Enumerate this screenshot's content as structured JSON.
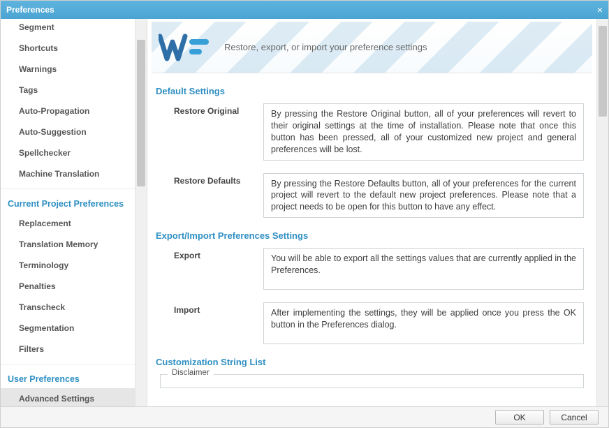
{
  "window": {
    "title": "Preferences"
  },
  "sidebar": {
    "top_items": [
      "Segment",
      "Shortcuts",
      "Warnings",
      "Tags",
      "Auto-Propagation",
      "Auto-Suggestion",
      "Spellchecker",
      "Machine Translation"
    ],
    "sections": [
      {
        "title": "Current Project Preferences",
        "items": [
          "Replacement",
          "Translation Memory",
          "Terminology",
          "Penalties",
          "Transcheck",
          "Segmentation",
          "Filters"
        ]
      },
      {
        "title": "User Preferences",
        "items": [
          "Advanced Settings"
        ]
      }
    ],
    "selected": "Advanced Settings"
  },
  "banner": {
    "text": "Restore, export, or import your preference settings"
  },
  "sections": {
    "default": {
      "title": "Default Settings",
      "restore_original": {
        "label": "Restore Original",
        "desc": "By pressing the Restore Original button, all of your preferences will revert to their original settings at the time of installation. Please note that once this button has been pressed, all of your customized new project and general preferences will be lost."
      },
      "restore_defaults": {
        "label": "Restore Defaults",
        "desc": "By pressing the Restore Defaults button, all of your preferences for the current project will revert to the default new project preferences. Please note that a project needs to be open for this button to have any effect."
      }
    },
    "exportimport": {
      "title": "Export/Import Preferences Settings",
      "export": {
        "label": "Export",
        "desc": "You will be able to export all the settings values that are currently applied in the Preferences."
      },
      "import": {
        "label": "Import",
        "desc": "After implementing the settings, they will be applied once you press the OK button in the Preferences dialog."
      }
    },
    "custom": {
      "title": "Customization String List",
      "disclaimer_label": "Disclaimer"
    }
  },
  "footer": {
    "ok": "OK",
    "cancel": "Cancel"
  }
}
